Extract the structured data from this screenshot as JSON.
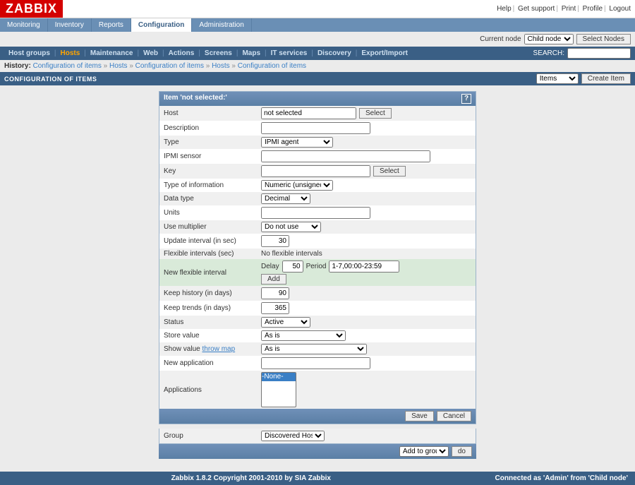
{
  "logo": "ZABBIX",
  "toplinks": [
    "Help",
    "Get support",
    "Print",
    "Profile",
    "Logout"
  ],
  "menu1": [
    "Monitoring",
    "Inventory",
    "Reports",
    "Configuration",
    "Administration"
  ],
  "menu1_active": 3,
  "nodebar": {
    "label": "Current node",
    "selected": "Child node",
    "button": "Select Nodes"
  },
  "menu2": [
    "Host groups",
    "Hosts",
    "Maintenance",
    "Web",
    "Actions",
    "Screens",
    "Maps",
    "IT services",
    "Discovery",
    "Export/Import"
  ],
  "menu2_active": 1,
  "search": {
    "label": "SEARCH:"
  },
  "history": {
    "label": "History:",
    "items": [
      "Configuration of items",
      "Hosts",
      "Configuration of items",
      "Hosts",
      "Configuration of items"
    ]
  },
  "titlebar": {
    "title": "CONFIGURATION OF ITEMS",
    "dropdown": "Items",
    "button": "Create Item"
  },
  "panel": {
    "header": "Item 'not selected:'",
    "rows": {
      "host": {
        "label": "Host",
        "value": "not selected",
        "button": "Select"
      },
      "description": {
        "label": "Description",
        "value": ""
      },
      "type": {
        "label": "Type",
        "selected": "IPMI agent"
      },
      "ipmi": {
        "label": "IPMI sensor",
        "value": ""
      },
      "key": {
        "label": "Key",
        "value": "",
        "button": "Select"
      },
      "typeinfo": {
        "label": "Type of information",
        "selected": "Numeric (unsigned)"
      },
      "datatype": {
        "label": "Data type",
        "selected": "Decimal"
      },
      "units": {
        "label": "Units",
        "value": ""
      },
      "multiplier": {
        "label": "Use multiplier",
        "selected": "Do not use"
      },
      "update": {
        "label": "Update interval (in sec)",
        "value": "30"
      },
      "flexible": {
        "label": "Flexible intervals (sec)",
        "text": "No flexible intervals"
      },
      "newflex": {
        "label": "New flexible interval",
        "delay_label": "Delay",
        "delay": "50",
        "period_label": "Period",
        "period": "1-7,00:00-23:59",
        "button": "Add"
      },
      "history": {
        "label": "Keep history (in days)",
        "value": "90"
      },
      "trends": {
        "label": "Keep trends (in days)",
        "value": "365"
      },
      "status": {
        "label": "Status",
        "selected": "Active"
      },
      "store": {
        "label": "Store value",
        "selected": "As is"
      },
      "showval": {
        "label": "Show value",
        "link": "throw map",
        "selected": "As is"
      },
      "newapp": {
        "label": "New application",
        "value": ""
      },
      "apps": {
        "label": "Applications",
        "option": "-None-"
      }
    },
    "footer": {
      "save": "Save",
      "cancel": "Cancel"
    }
  },
  "below": {
    "group": {
      "label": "Group",
      "selected": "Discovered Hosts"
    },
    "addto": {
      "dropdown": "Add to group",
      "button": "do"
    }
  },
  "footer": {
    "center": "Zabbix 1.8.2 Copyright 2001-2010 by SIA Zabbix",
    "right_prefix": "Connected as '",
    "right_user": "Admin",
    "right_mid": "' from '",
    "right_node": "Child node",
    "right_suffix": "'"
  }
}
